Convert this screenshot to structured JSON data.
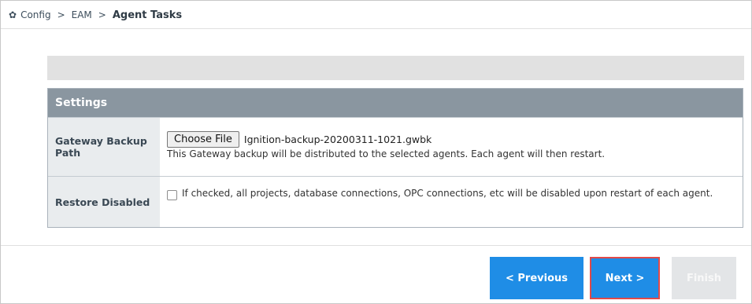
{
  "breadcrumb": {
    "icon": "gear-icon",
    "items": [
      "Config",
      "EAM",
      "Agent Tasks"
    ],
    "separator": ">"
  },
  "settings": {
    "header": "Settings",
    "gateway_backup": {
      "label": "Gateway Backup Path",
      "choose_file_label": "Choose File",
      "file_name": "Ignition-backup-20200311-1021.gwbk",
      "help": "This Gateway backup will be distributed to the selected agents. Each agent will then restart."
    },
    "restore_disabled": {
      "label": "Restore Disabled",
      "checked": false,
      "description": "If checked, all projects, database connections, OPC connections, etc will be disabled upon restart of each agent."
    }
  },
  "buttons": {
    "previous": "< Previous",
    "next": "Next >",
    "finish": "Finish"
  },
  "colors": {
    "primary_button": "#1f8de6",
    "highlight_border": "#e04a4a",
    "header_bg": "#8a96a0",
    "disabled_button": "#e3e5e7"
  }
}
